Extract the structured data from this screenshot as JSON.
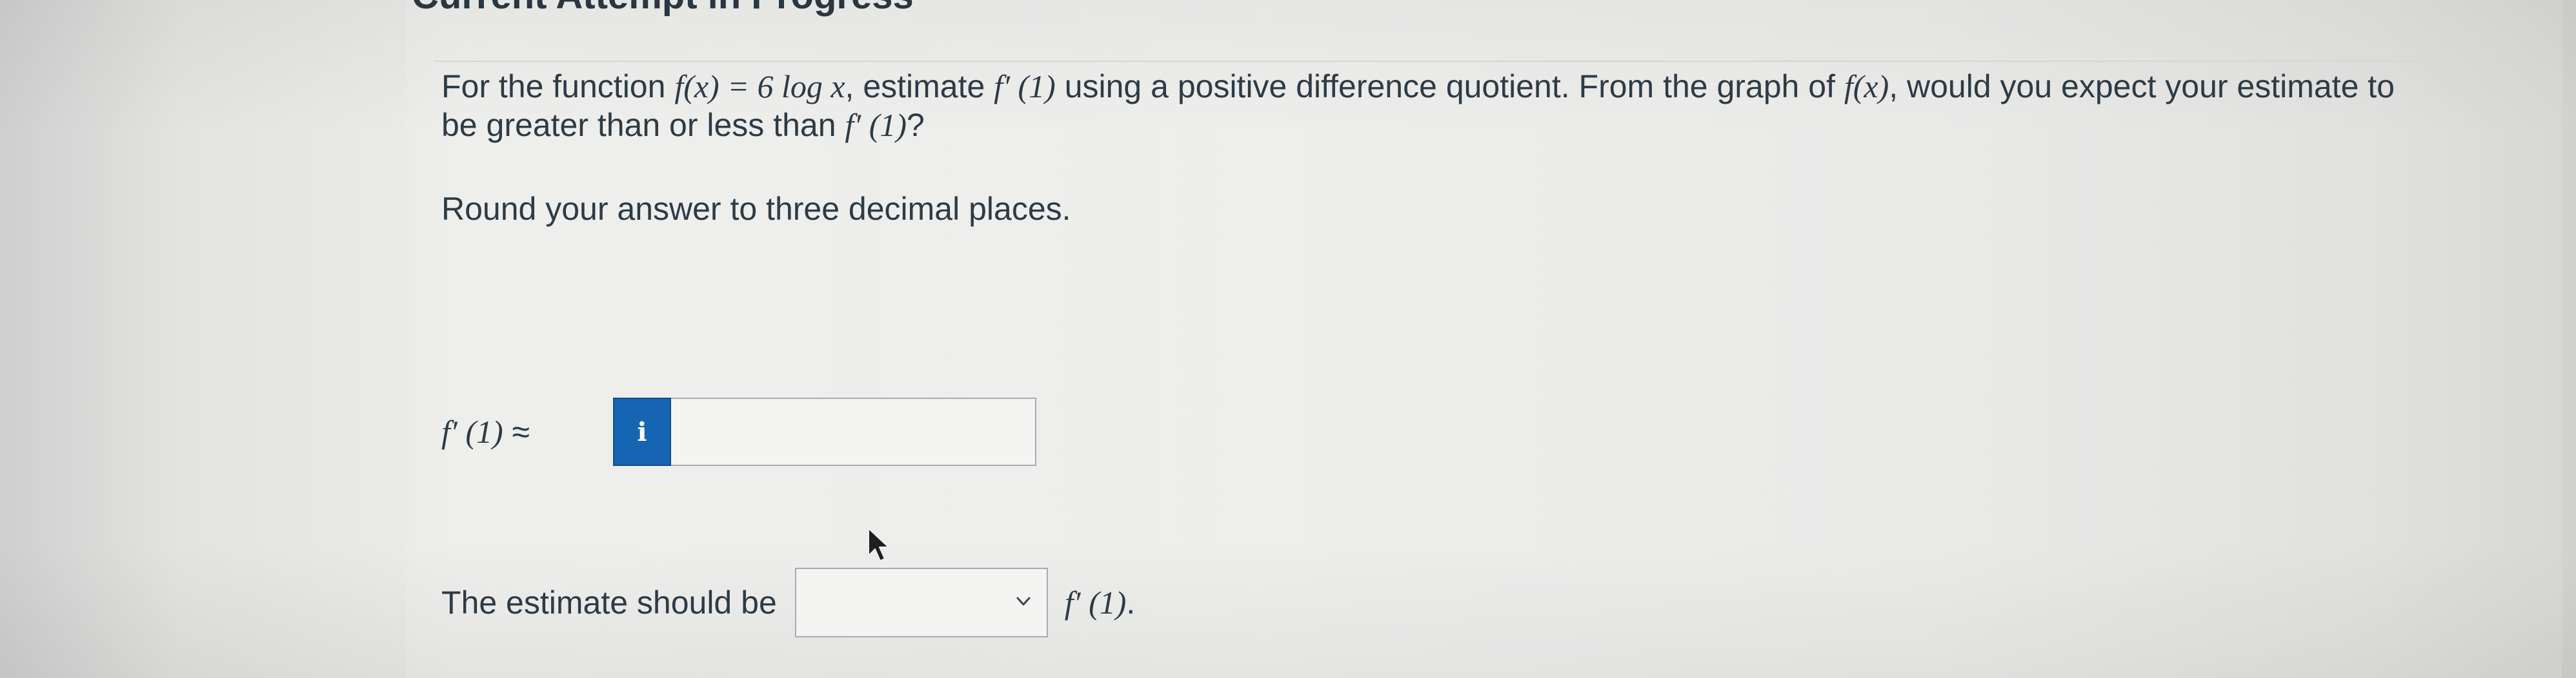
{
  "header": {
    "attempt_title": "Current Attempt in Progress"
  },
  "question": {
    "text_before_func": "For the function ",
    "func_def": "f(x) = 6 log x",
    "text_after_func": ", estimate ",
    "derivative_at_1": "f′ (1)",
    "text_middle": " using a positive difference quotient. From the graph of ",
    "func_name": "f(x)",
    "text_question": ", would you expect your estimate to be greater than or less than ",
    "text_end": "?"
  },
  "instruction": "Round your answer to three decimal places.",
  "answer": {
    "label_func": "f′ (1)",
    "label_approx": "≈",
    "info_icon_glyph": "i",
    "input_value": "",
    "input_placeholder": ""
  },
  "estimate": {
    "label": "The estimate should be",
    "select_value": "",
    "suffix_func": "f′ (1)",
    "suffix_end": "."
  },
  "colors": {
    "info_button": "#1565b3",
    "text": "#2d3b45",
    "border": "#a7acb0"
  },
  "icons": {
    "info": "info-icon",
    "dropdown": "chevron-down-icon",
    "pointer": "mouse-pointer-icon"
  }
}
